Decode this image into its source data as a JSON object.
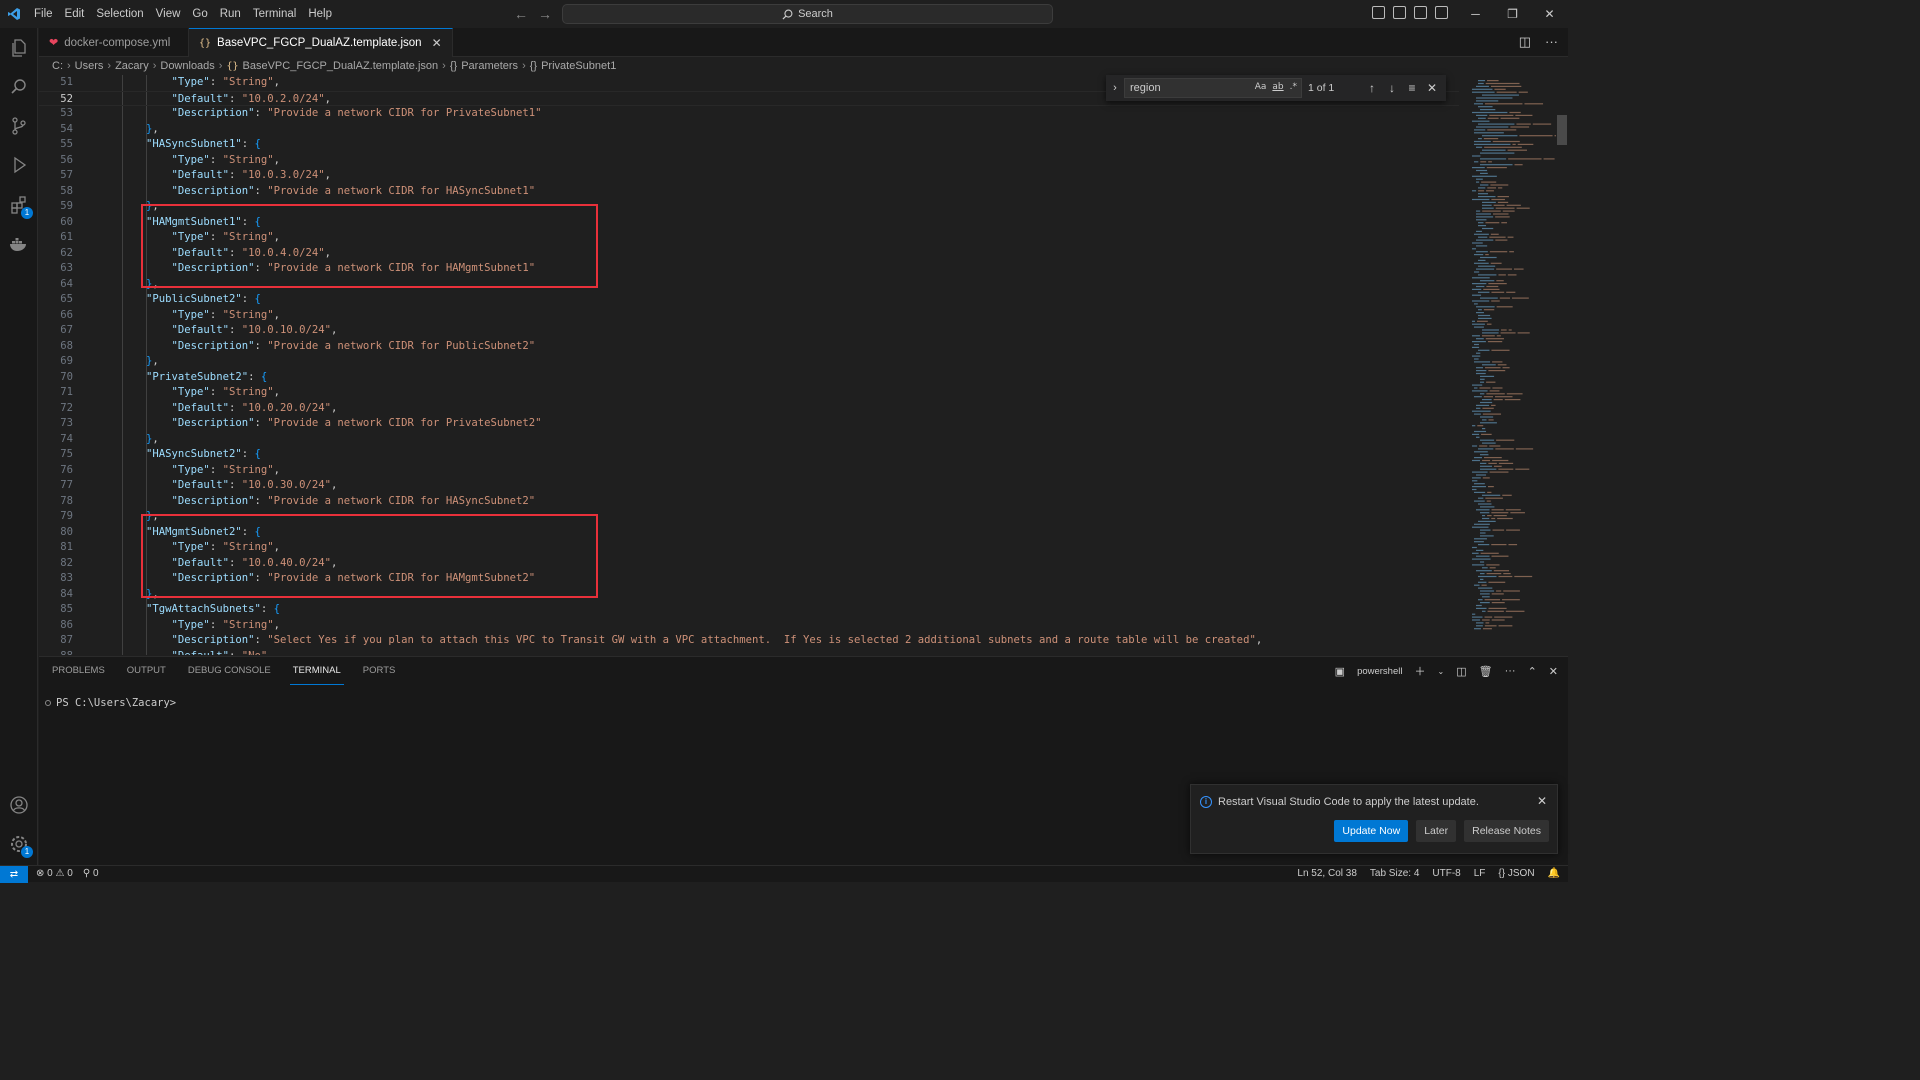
{
  "menu": [
    "File",
    "Edit",
    "Selection",
    "View",
    "Go",
    "Run",
    "Terminal",
    "Help"
  ],
  "search": {
    "label": "Search"
  },
  "tabs": [
    {
      "label": "docker-compose.yml",
      "active": false
    },
    {
      "label": "BaseVPC_FGCP_DualAZ.template.json",
      "active": true
    }
  ],
  "breadcrumb": [
    "C:",
    "Users",
    "Zacary",
    "Downloads",
    "BaseVPC_FGCP_DualAZ.template.json",
    "Parameters",
    "PrivateSubnet1"
  ],
  "find": {
    "value": "region",
    "count": "1 of 1",
    "opt_case": "Aa",
    "opt_word": "ab",
    "opt_regex": ".*"
  },
  "code": {
    "current_line": 52,
    "lines": [
      {
        "n": 51,
        "indent": 2,
        "key": "Type",
        "val": "String",
        "end": ","
      },
      {
        "n": 52,
        "indent": 2,
        "key": "Default",
        "val": "10.0.2.0/24",
        "end": ","
      },
      {
        "n": 53,
        "indent": 2,
        "key": "Description",
        "val": "Provide a network CIDR for PrivateSubnet1",
        "end": ""
      },
      {
        "n": 54,
        "indent": 1,
        "close": "},"
      },
      {
        "n": 55,
        "indent": 1,
        "key": "HASyncSubnet1",
        "open": "{"
      },
      {
        "n": 56,
        "indent": 2,
        "key": "Type",
        "val": "String",
        "end": ","
      },
      {
        "n": 57,
        "indent": 2,
        "key": "Default",
        "val": "10.0.3.0/24",
        "end": ","
      },
      {
        "n": 58,
        "indent": 2,
        "key": "Description",
        "val": "Provide a network CIDR for HASyncSubnet1",
        "end": ""
      },
      {
        "n": 59,
        "indent": 1,
        "close": "},"
      },
      {
        "n": 60,
        "indent": 1,
        "key": "HAMgmtSubnet1",
        "open": "{"
      },
      {
        "n": 61,
        "indent": 2,
        "key": "Type",
        "val": "String",
        "end": ","
      },
      {
        "n": 62,
        "indent": 2,
        "key": "Default",
        "val": "10.0.4.0/24",
        "end": ","
      },
      {
        "n": 63,
        "indent": 2,
        "key": "Description",
        "val": "Provide a network CIDR for HAMgmtSubnet1",
        "end": ""
      },
      {
        "n": 64,
        "indent": 1,
        "close": "},"
      },
      {
        "n": 65,
        "indent": 1,
        "key": "PublicSubnet2",
        "open": "{"
      },
      {
        "n": 66,
        "indent": 2,
        "key": "Type",
        "val": "String",
        "end": ","
      },
      {
        "n": 67,
        "indent": 2,
        "key": "Default",
        "val": "10.0.10.0/24",
        "end": ","
      },
      {
        "n": 68,
        "indent": 2,
        "key": "Description",
        "val": "Provide a network CIDR for PublicSubnet2",
        "end": ""
      },
      {
        "n": 69,
        "indent": 1,
        "close": "},"
      },
      {
        "n": 70,
        "indent": 1,
        "key": "PrivateSubnet2",
        "open": "{"
      },
      {
        "n": 71,
        "indent": 2,
        "key": "Type",
        "val": "String",
        "end": ","
      },
      {
        "n": 72,
        "indent": 2,
        "key": "Default",
        "val": "10.0.20.0/24",
        "end": ","
      },
      {
        "n": 73,
        "indent": 2,
        "key": "Description",
        "val": "Provide a network CIDR for PrivateSubnet2",
        "end": ""
      },
      {
        "n": 74,
        "indent": 1,
        "close": "},"
      },
      {
        "n": 75,
        "indent": 1,
        "key": "HASyncSubnet2",
        "open": "{"
      },
      {
        "n": 76,
        "indent": 2,
        "key": "Type",
        "val": "String",
        "end": ","
      },
      {
        "n": 77,
        "indent": 2,
        "key": "Default",
        "val": "10.0.30.0/24",
        "end": ","
      },
      {
        "n": 78,
        "indent": 2,
        "key": "Description",
        "val": "Provide a network CIDR for HASyncSubnet2",
        "end": ""
      },
      {
        "n": 79,
        "indent": 1,
        "close": "},"
      },
      {
        "n": 80,
        "indent": 1,
        "key": "HAMgmtSubnet2",
        "open": "{"
      },
      {
        "n": 81,
        "indent": 2,
        "key": "Type",
        "val": "String",
        "end": ","
      },
      {
        "n": 82,
        "indent": 2,
        "key": "Default",
        "val": "10.0.40.0/24",
        "end": ","
      },
      {
        "n": 83,
        "indent": 2,
        "key": "Description",
        "val": "Provide a network CIDR for HAMgmtSubnet2",
        "end": ""
      },
      {
        "n": 84,
        "indent": 1,
        "close": "},"
      },
      {
        "n": 85,
        "indent": 1,
        "key": "TgwAttachSubnets",
        "open": "{"
      },
      {
        "n": 86,
        "indent": 2,
        "key": "Type",
        "val": "String",
        "end": ","
      },
      {
        "n": 87,
        "indent": 2,
        "key": "Description",
        "val": "Select Yes if you plan to attach this VPC to Transit GW with a VPC attachment.  If Yes is selected 2 additional subnets and a route table will be created",
        "end": ","
      },
      {
        "n": 88,
        "indent": 2,
        "key": "Default",
        "val": "No",
        "end": ","
      }
    ],
    "highlighted_lines": [
      [
        60,
        64
      ],
      [
        80,
        84
      ]
    ]
  },
  "panel": {
    "tabs": [
      "PROBLEMS",
      "OUTPUT",
      "DEBUG CONSOLE",
      "TERMINAL",
      "PORTS"
    ],
    "active_tab": "TERMINAL",
    "shell": "powershell",
    "prompt": "PS C:\\Users\\Zacary>"
  },
  "notification": {
    "message": "Restart Visual Studio Code to apply the latest update.",
    "buttons": [
      "Update Now",
      "Later",
      "Release Notes"
    ]
  },
  "status": {
    "errors": "0",
    "warnings": "0",
    "ports": "0",
    "position": "Ln 52, Col 38",
    "tab_size": "Tab Size: 4",
    "encoding": "UTF-8",
    "eol": "LF",
    "language": "JSON"
  },
  "colors": {
    "accent": "#0078d4",
    "highlight_box": "#e8303a",
    "string": "#ce9178",
    "key": "#9cdcfe"
  }
}
